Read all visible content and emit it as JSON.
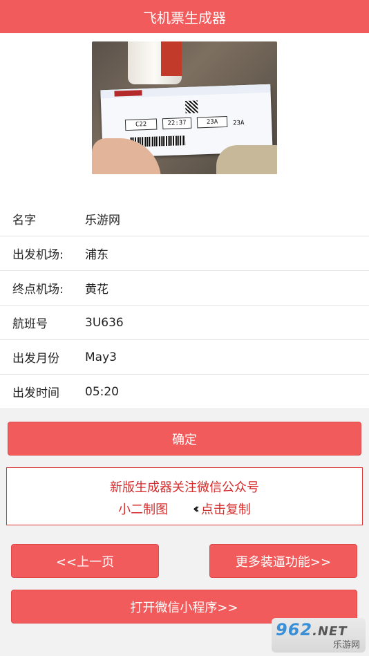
{
  "header": {
    "title": "飞机票生成器"
  },
  "hero": {
    "ticket": {
      "gate": "C22",
      "time": "22:37",
      "seat": "23A",
      "stub_seat": "23A"
    }
  },
  "form": {
    "rows": [
      {
        "label": "名字",
        "value": "乐游网"
      },
      {
        "label": "出发机场:",
        "value": "浦东"
      },
      {
        "label": "终点机场:",
        "value": "黄花"
      },
      {
        "label": "航班号",
        "value": "3U636"
      },
      {
        "label": "出发月份",
        "value": "May3"
      },
      {
        "label": "出发时间",
        "value": "05:20"
      }
    ]
  },
  "confirm_label": "确定",
  "notice": {
    "line1": "新版生成器关注微信公众号",
    "account": "小二制图",
    "copy_label": "点击复制",
    "copy_icon": "double-chevron-left-icon"
  },
  "nav": {
    "prev_label": "<<上一页",
    "more_label": "更多装逼功能>>",
    "miniprogram_label": "打开微信小程序>>"
  },
  "watermark": {
    "brand": "962",
    "suffix": ".NET",
    "sub": "乐游网"
  },
  "colors": {
    "accent": "#f25b5b",
    "notice_text": "#d52b2b"
  }
}
